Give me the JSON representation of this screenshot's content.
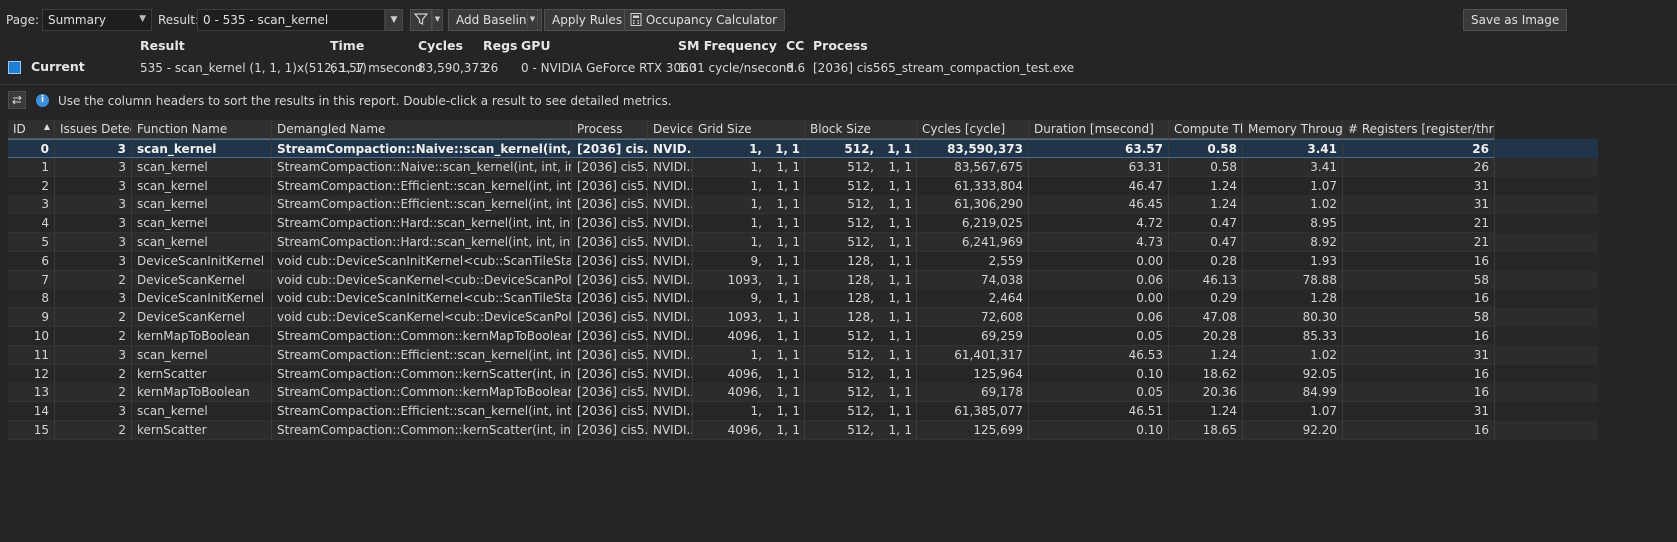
{
  "toolbar": {
    "page_label": "Page:",
    "page_value": "Summary",
    "result_label": "Result:",
    "result_value": "0 -   535 - scan_kernel",
    "add_baseline": "Add Baseline",
    "apply_rules": "Apply Rules",
    "occupancy": "Occupancy Calculator",
    "save_image": "Save as Image"
  },
  "header": {
    "columns": [
      "Result",
      "Time",
      "Cycles",
      "Regs",
      "GPU",
      "SM Frequency",
      "CC",
      "Process"
    ],
    "current_label": "Current",
    "current": {
      "result": "535 - scan_kernel (1, 1, 1)x(512, 1, 1)",
      "time": "63.57 msecond",
      "cycles": "83,590,373",
      "regs": "26",
      "gpu": "0 - NVIDIA GeForce RTX 3060",
      "sm_freq": "1.31 cycle/nsecond",
      "cc": "8.6",
      "process": "[2036] cis565_stream_compaction_test.exe"
    }
  },
  "info_text": "Use the column headers to sort the results in this report. Double-click a result to see detailed metrics.",
  "table": {
    "columns": [
      "ID",
      "Issues Detecte",
      "Function Name",
      "Demangled Name",
      "Process",
      "Device N",
      "Grid Size",
      "Block Size",
      "Cycles [cycle]",
      "Duration [msecond]",
      "Compute Thro",
      "Memory Throughput [",
      "# Registers [register/thread"
    ],
    "rows": [
      [
        "0",
        "3",
        "scan_kernel",
        "StreamCompaction::Naive::scan_kernel(int, int, ...",
        "[2036] cis...",
        "NVID...",
        "1,",
        "1,",
        "1",
        "512,",
        "1,",
        "1",
        "83,590,373",
        "63.57",
        "0.58",
        "3.41",
        "26"
      ],
      [
        "1",
        "3",
        "scan_kernel",
        "StreamCompaction::Naive::scan_kernel(int, int, int, int *, i...",
        "[2036] cis5...",
        "NVIDI...",
        "1,",
        "1,",
        "1",
        "512,",
        "1,",
        "1",
        "83,567,675",
        "63.31",
        "0.58",
        "3.41",
        "26"
      ],
      [
        "2",
        "3",
        "scan_kernel",
        "StreamCompaction::Efficient::scan_kernel(int, int, int, int *)",
        "[2036] cis5...",
        "NVIDI...",
        "1,",
        "1,",
        "1",
        "512,",
        "1,",
        "1",
        "61,333,804",
        "46.47",
        "1.24",
        "1.07",
        "31"
      ],
      [
        "3",
        "3",
        "scan_kernel",
        "StreamCompaction::Efficient::scan_kernel(int, int, int, int *)",
        "[2036] cis5...",
        "NVIDI...",
        "1,",
        "1,",
        "1",
        "512,",
        "1,",
        "1",
        "61,306,290",
        "46.45",
        "1.24",
        "1.02",
        "31"
      ],
      [
        "4",
        "3",
        "scan_kernel",
        "StreamCompaction::Hard::scan_kernel(int, int, int, int *)",
        "[2036] cis5...",
        "NVIDI...",
        "1,",
        "1,",
        "1",
        "512,",
        "1,",
        "1",
        "6,219,025",
        "4.72",
        "0.47",
        "8.95",
        "21"
      ],
      [
        "5",
        "3",
        "scan_kernel",
        "StreamCompaction::Hard::scan_kernel(int, int, int, int *)",
        "[2036] cis5...",
        "NVIDI...",
        "1,",
        "1,",
        "1",
        "512,",
        "1,",
        "1",
        "6,241,969",
        "4.73",
        "0.47",
        "8.92",
        "21"
      ],
      [
        "6",
        "3",
        "DeviceScanInitKernel",
        "void cub::DeviceScanInitKernel<cub::ScanTileState<int, (...",
        "[2036] cis5...",
        "NVIDI...",
        "9,",
        "1,",
        "1",
        "128,",
        "1,",
        "1",
        "2,559",
        "0.00",
        "0.28",
        "1.93",
        "16"
      ],
      [
        "7",
        "2",
        "DeviceScanKernel",
        "void cub::DeviceScanKernel<cub::DeviceScanPolicy<int>:...",
        "[2036] cis5...",
        "NVIDI...",
        "1093,",
        "1,",
        "1",
        "128,",
        "1,",
        "1",
        "74,038",
        "0.06",
        "46.13",
        "78.88",
        "58"
      ],
      [
        "8",
        "3",
        "DeviceScanInitKernel",
        "void cub::DeviceScanInitKernel<cub::ScanTileState<int, (...",
        "[2036] cis5...",
        "NVIDI...",
        "9,",
        "1,",
        "1",
        "128,",
        "1,",
        "1",
        "2,464",
        "0.00",
        "0.29",
        "1.28",
        "16"
      ],
      [
        "9",
        "2",
        "DeviceScanKernel",
        "void cub::DeviceScanKernel<cub::DeviceScanPolicy<int>:...",
        "[2036] cis5...",
        "NVIDI...",
        "1093,",
        "1,",
        "1",
        "128,",
        "1,",
        "1",
        "72,608",
        "0.06",
        "47.08",
        "80.30",
        "58"
      ],
      [
        "10",
        "2",
        "kernMapToBoolean",
        "StreamCompaction::Common::kernMapToBoolean(int, i...",
        "[2036] cis5...",
        "NVIDI...",
        "4096,",
        "1,",
        "1",
        "512,",
        "1,",
        "1",
        "69,259",
        "0.05",
        "20.28",
        "85.33",
        "16"
      ],
      [
        "11",
        "3",
        "scan_kernel",
        "StreamCompaction::Efficient::scan_kernel(int, int, int, int *)",
        "[2036] cis5...",
        "NVIDI...",
        "1,",
        "1,",
        "1",
        "512,",
        "1,",
        "1",
        "61,401,317",
        "46.53",
        "1.24",
        "1.02",
        "31"
      ],
      [
        "12",
        "2",
        "kernScatter",
        "StreamCompaction::Common::kernScatter(int, int *, con...",
        "[2036] cis5...",
        "NVIDI...",
        "4096,",
        "1,",
        "1",
        "512,",
        "1,",
        "1",
        "125,964",
        "0.10",
        "18.62",
        "92.05",
        "16"
      ],
      [
        "13",
        "2",
        "kernMapToBoolean",
        "StreamCompaction::Common::kernMapToBoolean(int, i...",
        "[2036] cis5...",
        "NVIDI...",
        "4096,",
        "1,",
        "1",
        "512,",
        "1,",
        "1",
        "69,178",
        "0.05",
        "20.36",
        "84.99",
        "16"
      ],
      [
        "14",
        "3",
        "scan_kernel",
        "StreamCompaction::Efficient::scan_kernel(int, int, int, int *)",
        "[2036] cis5...",
        "NVIDI...",
        "1,",
        "1,",
        "1",
        "512,",
        "1,",
        "1",
        "61,385,077",
        "46.51",
        "1.24",
        "1.07",
        "31"
      ],
      [
        "15",
        "2",
        "kernScatter",
        "StreamCompaction::Common::kernScatter(int, int *, con...",
        "[2036] cis5...",
        "NVIDI...",
        "4096,",
        "1,",
        "1",
        "512,",
        "1,",
        "1",
        "125,699",
        "0.10",
        "18.65",
        "92.20",
        "16"
      ]
    ]
  },
  "colors": {
    "background": "#252526",
    "selected_row": "#21354a",
    "accent": "#1e7fd4"
  },
  "icons": [
    "filter-icon",
    "calculator-icon",
    "info-icon",
    "swap-icon",
    "sort-asc-icon",
    "chevron-down-icon"
  ]
}
